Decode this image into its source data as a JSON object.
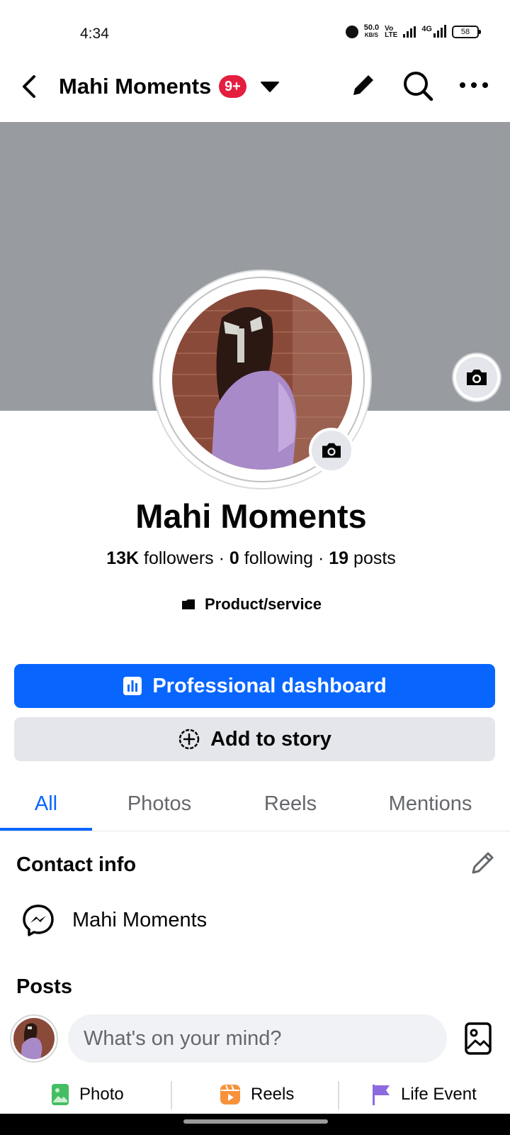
{
  "status_bar": {
    "time": "4:34",
    "net_speed_value": "50.0",
    "net_speed_unit": "KB/S",
    "volte_top": "Vo",
    "volte_bottom": "LTE",
    "network": "4G",
    "battery": "58"
  },
  "top_nav": {
    "title": "Mahi Moments",
    "notification_badge": "9+",
    "icons": [
      "back-arrow-icon",
      "caret-down-icon",
      "pencil-icon",
      "search-icon",
      "more-icon"
    ]
  },
  "profile": {
    "name": "Mahi Moments",
    "followers_count": "13K",
    "followers_label": "followers",
    "following_count": "0",
    "following_label": "following",
    "posts_count": "19",
    "posts_label": "posts",
    "category": "Product/service"
  },
  "buttons": {
    "dashboard_label": "Professional dashboard",
    "story_label": "Add to story"
  },
  "tabs": [
    {
      "label": "All",
      "active": true
    },
    {
      "label": "Photos",
      "active": false
    },
    {
      "label": "Reels",
      "active": false
    },
    {
      "label": "Mentions",
      "active": false
    }
  ],
  "contact_info": {
    "title": "Contact info",
    "messenger_name": "Mahi Moments"
  },
  "posts": {
    "title": "Posts",
    "composer_placeholder": "What's on your mind?"
  },
  "post_actions": [
    {
      "label": "Photo",
      "icon": "photo-icon",
      "color": "#45bd62"
    },
    {
      "label": "Reels",
      "icon": "reels-icon",
      "color": "#f7923b"
    },
    {
      "label": "Life Event",
      "icon": "flag-icon",
      "color": "#8c6be0"
    }
  ],
  "colors": {
    "accent": "#0866ff",
    "badge": "#e41e3f",
    "cover": "#989b9f"
  }
}
